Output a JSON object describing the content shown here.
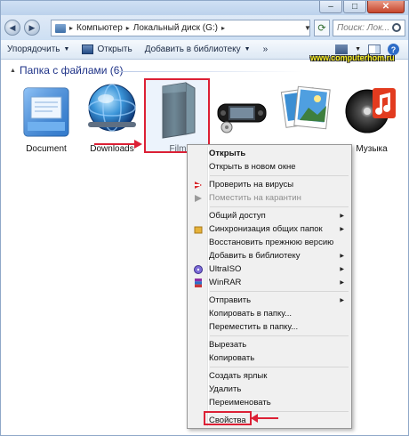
{
  "address": {
    "path": [
      "Компьютер",
      "Локальный диск (G:)"
    ],
    "separator": "▸"
  },
  "search": {
    "placeholder": "Поиск: Лок..."
  },
  "toolbar": {
    "organize": "Упорядочить",
    "open": "Открыть",
    "add_library": "Добавить в библиотеку",
    "more": "»"
  },
  "group": {
    "title": "Папка с файлами (6)"
  },
  "watermark": "www.computerhom.ru",
  "files": [
    {
      "label": "Document",
      "icon": "document-folder-icon"
    },
    {
      "label": "Downloads",
      "icon": "downloads-globe-icon"
    },
    {
      "label": "Film",
      "icon": "film-folder-icon"
    },
    {
      "label": "",
      "icon": "game-console-icon"
    },
    {
      "label": "",
      "icon": "wallpaper-photos-icon"
    },
    {
      "label": "Музыка",
      "icon": "music-folder-icon"
    }
  ],
  "menu": {
    "items": [
      {
        "label": "Открыть",
        "bold": true
      },
      {
        "label": "Открыть в новом окне"
      },
      {
        "label": "Проверить на вирусы",
        "icon": "antivirus-icon"
      },
      {
        "label": "Поместить на карантин",
        "icon": "quarantine-icon",
        "disabled": true
      },
      {
        "label": "Общий доступ",
        "submenu": true
      },
      {
        "label": "Синхронизация общих папок",
        "icon": "sync-icon",
        "submenu": true
      },
      {
        "label": "Восстановить прежнюю версию"
      },
      {
        "label": "Добавить в библиотеку",
        "submenu": true
      },
      {
        "label": "UltraISO",
        "icon": "ultraiso-icon",
        "submenu": true
      },
      {
        "label": "WinRAR",
        "icon": "winrar-icon",
        "submenu": true
      },
      {
        "label": "Отправить",
        "submenu": true
      },
      {
        "label": "Копировать в папку..."
      },
      {
        "label": "Переместить в папку..."
      },
      {
        "label": "Вырезать"
      },
      {
        "label": "Копировать"
      },
      {
        "label": "Создать ярлык"
      },
      {
        "label": "Удалить"
      },
      {
        "label": "Переименовать"
      },
      {
        "label": "Свойства"
      }
    ]
  },
  "colors": {
    "highlight_red": "#dc2035",
    "group_title": "#1e3287",
    "watermark": "#f8f023"
  }
}
